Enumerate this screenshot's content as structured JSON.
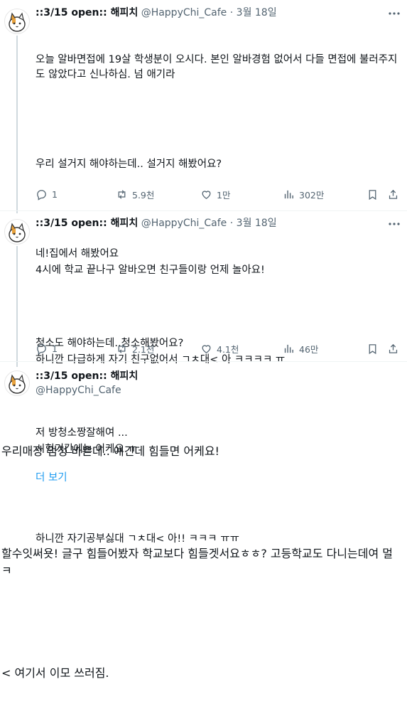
{
  "tweets": [
    {
      "name": "::3/15 open:: 해피치",
      "handle": "@HappyChi_Cafe",
      "sep": "·",
      "date": "3월 18일",
      "text": [
        "오늘 알바면접에 19살 학생분이 오시다. 본인 알바경험 없어서 다들 면접에 불러주지도 않았다고 신나하심. 넘 애기라",
        "우리 설거지 해야하는데.. 설거지 해봤어요?",
        "네!집에서 해봤어요",
        "청소도 해야하는데..청소해봤어요?",
        "저 방청소짱잘해여 ..."
      ],
      "show_more": "더 보기",
      "replies": "1",
      "retweets": "5.9천",
      "likes": "1만",
      "views": "302만"
    },
    {
      "name": "::3/15 open:: 해피치",
      "handle": "@HappyChi_Cafe",
      "sep": "·",
      "date": "3월 18일",
      "text": [
        "4시에 학교 끝나구 알바오면 친구들이랑 언제 놀아요!",
        "하니깐 다급하게 자기 친구없어서 ㄱㅊ대< 아 ㅋㅋㅋㅋ ㅠ",
        "시험기간에는 어케요 ㅠ",
        "하니깐 자기공부싫대 ㄱㅊ대< 아!! ㅋㅋㅋ ㅠㅠ"
      ],
      "replies": "1",
      "retweets": "2.1천",
      "likes": "4.1천",
      "views": "46만"
    },
    {
      "name": "::3/15 open:: 해피치",
      "handle": "@HappyChi_Cafe",
      "text": [
        "우리매장 엄청 바쁜데.. 애긴데 힘들면 어케요!",
        "할수잇써욧! 글구 힘들어봤자 학교보다 힘들겟서요ㅎㅎ? 고등학교도 다니는데여 멀ㅋ",
        "< 여기서 이모 쓰러짐."
      ]
    }
  ],
  "icons": {
    "more": "more-horizontal-icon",
    "reply": "reply-icon",
    "retweet": "retweet-icon",
    "like": "heart-icon",
    "views": "views-chart-icon",
    "bookmark": "bookmark-icon",
    "share": "share-icon"
  },
  "colors": {
    "text": "#0f1419",
    "muted": "#536471",
    "link": "#1d9bf0",
    "divider": "#eff3f4"
  }
}
